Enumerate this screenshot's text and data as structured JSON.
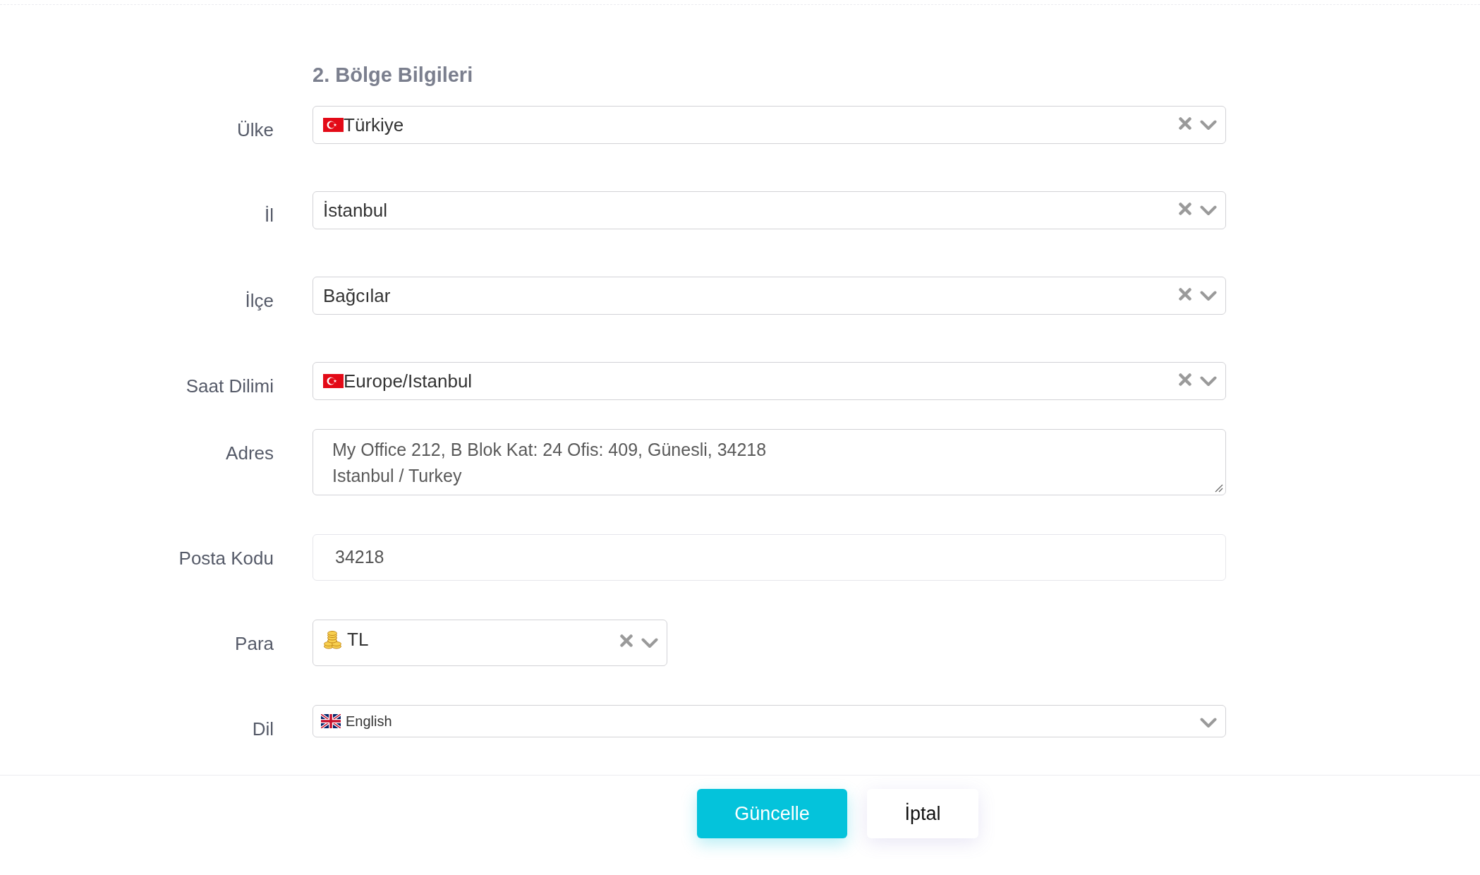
{
  "section": {
    "title": "2. Bölge Bilgileri"
  },
  "fields": [
    {
      "label": "Ülke",
      "kind": "flag_select",
      "value": "Türkiye",
      "clearable": true
    },
    {
      "label": "İl",
      "kind": "select",
      "value": "İstanbul",
      "clearable": true
    },
    {
      "label": "İlçe",
      "kind": "select",
      "value": "Bağcılar",
      "clearable": true
    },
    {
      "label": "Saat Dilimi",
      "kind": "flag_select",
      "value": "Europe/Istanbul",
      "clearable": true
    },
    {
      "label": "Adres",
      "kind": "textarea",
      "value": "My Office 212, B Blok Kat: 24 Ofis: 409, Günesli, 34218\nIstanbul / Turkey"
    },
    {
      "label": "Posta Kodu",
      "kind": "text",
      "value": "34218"
    },
    {
      "label": "Para",
      "kind": "currency_select",
      "value": "TL",
      "clearable": true
    },
    {
      "label": "Dil",
      "kind": "language_select",
      "value": "English",
      "clearable": false
    }
  ],
  "buttons": [
    {
      "label": "Güncelle",
      "kind": "primary"
    },
    {
      "label": "İptal",
      "kind": "secondary"
    }
  ]
}
